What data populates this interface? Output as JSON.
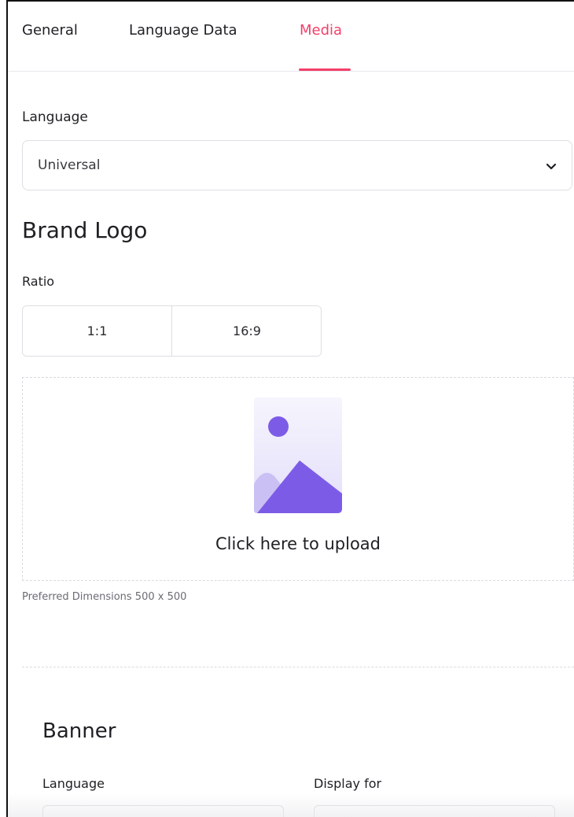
{
  "tabs": [
    {
      "label": "General"
    },
    {
      "label": "Language Data"
    },
    {
      "label": "Media"
    }
  ],
  "colors": {
    "accent": "#f43f6a",
    "image_icon": "#7c5ce6"
  },
  "language": {
    "label": "Language",
    "selected": "Universal"
  },
  "brand_logo": {
    "title": "Brand Logo",
    "ratio_label": "Ratio",
    "ratios": [
      "1:1",
      "16:9"
    ],
    "upload_text": "Click here to upload",
    "preferred_dimensions": "Preferred Dimensions 500 x 500"
  },
  "banner": {
    "title": "Banner",
    "language_label": "Language",
    "display_for_label": "Display for"
  },
  "icons": {
    "dropdown": "chevron-down-icon",
    "upload": "image-placeholder-icon"
  }
}
